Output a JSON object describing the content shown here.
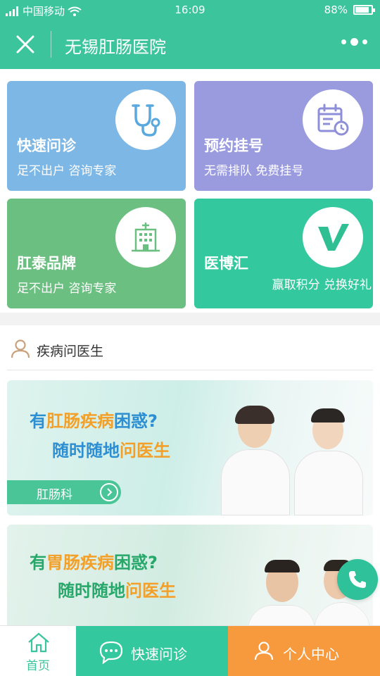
{
  "status_bar": {
    "carrier": "中国移动",
    "time": "16:09",
    "battery": "88%",
    "battery_level": 0.88
  },
  "nav": {
    "title": "无锡肛肠医院"
  },
  "grid": [
    {
      "title": "快速问诊",
      "subtitle": "足不出户 咨询专家",
      "icon": "stethoscope-icon"
    },
    {
      "title": "预约挂号",
      "subtitle": "无需排队 免费挂号",
      "icon": "calendar-clock-icon"
    },
    {
      "title": "肛泰品牌",
      "subtitle": "足不出户 咨询专家",
      "icon": "hospital-building-icon"
    },
    {
      "title": "医博汇",
      "subtitle": "赢取积分 兑换好礼",
      "icon": "v-logo-icon"
    }
  ],
  "section": {
    "title": "疾病问医生",
    "icon": "person-outline-icon"
  },
  "banners": [
    {
      "line1_a": "有",
      "line1_b": "肛肠疾病",
      "line1_c": "困惑?",
      "line2_a": "随时随地",
      "line2_b": "问医生",
      "dept": "肛肠科"
    },
    {
      "line1_a": "有",
      "line1_b": "胃肠疾病",
      "line1_c": "困惑?",
      "line2_a": "随时随地",
      "line2_b": "问医生"
    }
  ],
  "tabbar": {
    "home": "首页",
    "quick": "快速问诊",
    "me": "个人中心"
  },
  "colors": {
    "primary": "#3cc49c",
    "orange": "#f79a3d",
    "blue_card": "#7cb7e6",
    "purple_card": "#9a9bdf",
    "green_card": "#6bbf80"
  }
}
